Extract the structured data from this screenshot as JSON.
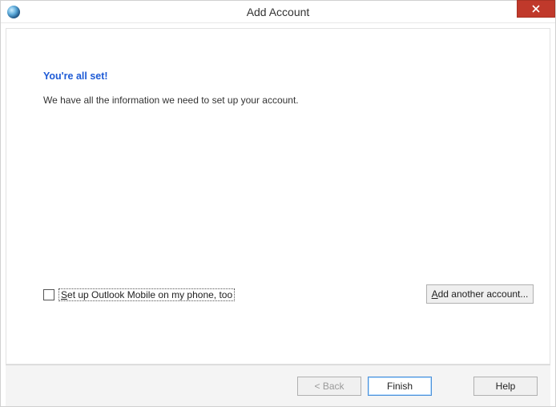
{
  "titlebar": {
    "title": "Add Account"
  },
  "main": {
    "heading": "You're all set!",
    "description": "We have all the information we need to set up your account.",
    "checkbox_label_pre": "S",
    "checkbox_label_rest": "et up Outlook Mobile on my phone, too",
    "add_another_pre": "A",
    "add_another_rest": "dd another account..."
  },
  "footer": {
    "back_label": "< Back",
    "finish_label": "Finish",
    "help_label": "Help"
  }
}
